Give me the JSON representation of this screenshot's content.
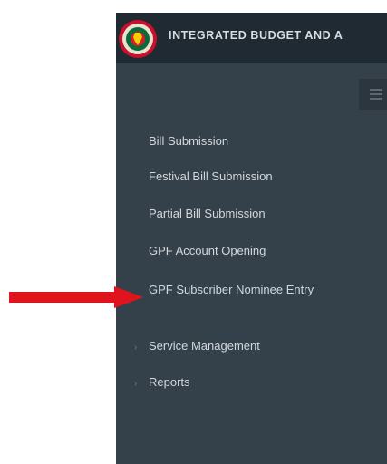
{
  "app": {
    "title": "INTEGRATED BUDGET AND A",
    "logo_icon": "government-emblem-icon"
  },
  "header": {
    "background": "#1f2a33"
  },
  "sidebar": {
    "background": "#34404a",
    "toggle_icon": "hamburger-menu-icon",
    "items": [
      {
        "label": "Bill Submission"
      },
      {
        "label": "Festival Bill Submission"
      },
      {
        "label": "Partial Bill Submission"
      },
      {
        "label": "GPF Account Opening"
      },
      {
        "label": "GPF Subscriber Nominee Entry"
      },
      {
        "label": "Service Management",
        "icon": "chevron-right-icon"
      },
      {
        "label": "Reports",
        "icon": "chevron-right-icon"
      }
    ]
  },
  "annotation": {
    "icon": "red-arrow-icon",
    "color": "#e0141c",
    "points_to": "GPF Subscriber Nominee Entry"
  }
}
